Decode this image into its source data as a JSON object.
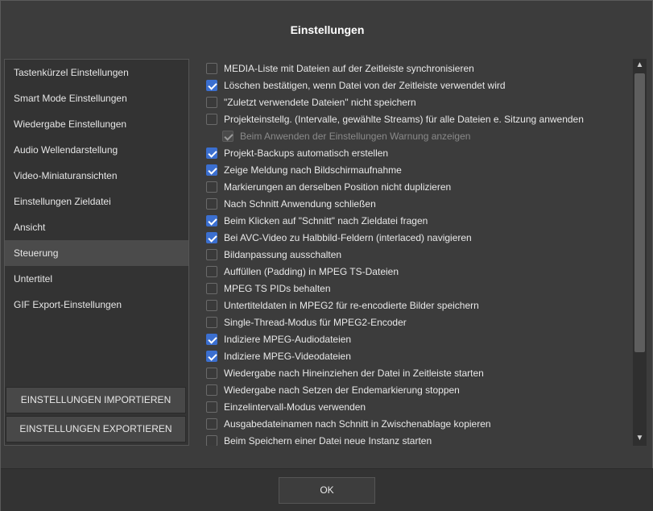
{
  "dialog": {
    "title": "Einstellungen",
    "ok_label": "OK"
  },
  "sidebar": {
    "items": [
      {
        "label": "Tastenkürzel Einstellungen",
        "active": false
      },
      {
        "label": "Smart Mode Einstellungen",
        "active": false
      },
      {
        "label": "Wiedergabe Einstellungen",
        "active": false
      },
      {
        "label": "Audio Wellendarstellung",
        "active": false
      },
      {
        "label": "Video-Miniaturansichten",
        "active": false
      },
      {
        "label": "Einstellungen Zieldatei",
        "active": false
      },
      {
        "label": "Ansicht",
        "active": false
      },
      {
        "label": "Steuerung",
        "active": true
      },
      {
        "label": "Untertitel",
        "active": false
      },
      {
        "label": "GIF Export-Einstellungen",
        "active": false
      }
    ],
    "import_label": "EINSTELLUNGEN IMPORTIEREN",
    "export_label": "EINSTELLUNGEN EXPORTIEREN"
  },
  "options": [
    {
      "label": "MEDIA-Liste mit Dateien auf der Zeitleiste synchronisieren",
      "checked": false
    },
    {
      "label": "Löschen bestätigen, wenn Datei von der Zeitleiste verwendet wird",
      "checked": true
    },
    {
      "label": "\"Zuletzt verwendete Dateien\" nicht speichern",
      "checked": false
    },
    {
      "label": "Projekteinstellg. (Intervalle, gewählte Streams) für alle Dateien e. Sitzung anwenden",
      "checked": false
    },
    {
      "label": "Beim Anwenden der Einstellungen Warnung anzeigen",
      "checked": true,
      "disabled": true
    },
    {
      "label": "Projekt-Backups automatisch erstellen",
      "checked": true
    },
    {
      "label": "Zeige Meldung nach Bildschirmaufnahme",
      "checked": true
    },
    {
      "label": "Markierungen an derselben Position nicht duplizieren",
      "checked": false
    },
    {
      "label": "Nach Schnitt Anwendung schließen",
      "checked": false
    },
    {
      "label": "Beim Klicken auf \"Schnitt\" nach Zieldatei fragen",
      "checked": true
    },
    {
      "label": "Bei AVC-Video zu Halbbild-Feldern (interlaced) navigieren",
      "checked": true
    },
    {
      "label": "Bildanpassung ausschalten",
      "checked": false
    },
    {
      "label": "Auffüllen (Padding) in MPEG TS-Dateien",
      "checked": false
    },
    {
      "label": "MPEG TS PIDs behalten",
      "checked": false
    },
    {
      "label": "Untertiteldaten in MPEG2 für re-encodierte Bilder speichern",
      "checked": false
    },
    {
      "label": "Single-Thread-Modus für MPEG2-Encoder",
      "checked": false
    },
    {
      "label": "Indiziere MPEG-Audiodateien",
      "checked": true
    },
    {
      "label": "Indiziere MPEG-Videodateien",
      "checked": true
    },
    {
      "label": "Wiedergabe nach Hineinziehen der Datei in Zeitleiste starten",
      "checked": false
    },
    {
      "label": "Wiedergabe nach Setzen der Endemarkierung stoppen",
      "checked": false
    },
    {
      "label": "Einzelintervall-Modus verwenden",
      "checked": false
    },
    {
      "label": "Ausgabedateinamen nach Schnitt in Zwischenablage kopieren",
      "checked": false
    },
    {
      "label": "Beim Speichern einer Datei neue Instanz starten",
      "checked": false
    }
  ],
  "colors": {
    "accent": "#3b6fd0",
    "background": "#3c3c3c",
    "sidebar_active": "#4b4b4b"
  },
  "icons": {
    "scroll_up": "chevron-up-icon",
    "scroll_down": "chevron-down-icon",
    "check": "checkmark-icon"
  }
}
